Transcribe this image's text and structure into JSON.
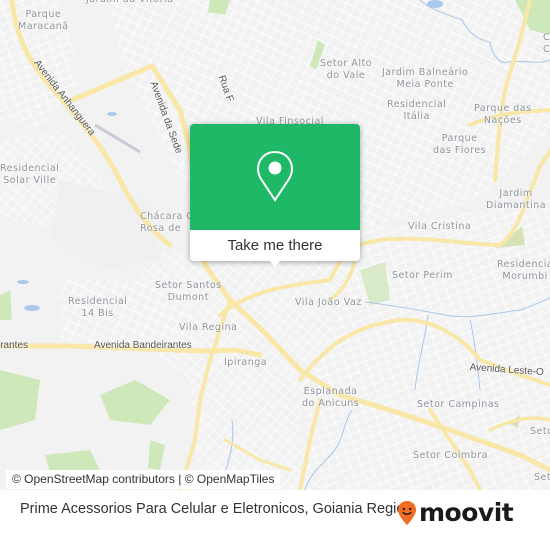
{
  "map": {
    "neighborhoods": [
      {
        "id": "parque-maracana",
        "label": "Parque\nMaracanã"
      },
      {
        "id": "setor-alto-do-vale",
        "label": "Setor Alto\ndo Vale"
      },
      {
        "id": "jardim-balneario",
        "label": "Jardim Balneário\nMeia Ponte"
      },
      {
        "id": "residencial-italia",
        "label": "Residencial\nItália"
      },
      {
        "id": "parque-das-nacoes",
        "label": "Parque das\nNações"
      },
      {
        "id": "parque-das-flores",
        "label": "Parque\ndas Flores"
      },
      {
        "id": "residencial-solar-ville",
        "label": "Residencial\nSolar Ville"
      },
      {
        "id": "vila-finsocial",
        "label": "Vila Finsocial"
      },
      {
        "id": "chacara-rosa",
        "label": "Chácara C\nRosa de"
      },
      {
        "id": "jardim-diamantina",
        "label": "Jardim\nDiamantina"
      },
      {
        "id": "vila-cristina",
        "label": "Vila Cristina"
      },
      {
        "id": "setor-perim",
        "label": "Setor Perim"
      },
      {
        "id": "residencial-morumbi",
        "label": "Residencia\nMorumbi"
      },
      {
        "id": "setor-santos-dumont",
        "label": "Setor Santos\nDumont"
      },
      {
        "id": "residencial-14-bis",
        "label": "Residencial\n14 Bis"
      },
      {
        "id": "vila-joao-vaz",
        "label": "Vila João Vaz"
      },
      {
        "id": "vila-regina",
        "label": "Vila Regina"
      },
      {
        "id": "ipiranga",
        "label": "Ipiranga"
      },
      {
        "id": "esplanada",
        "label": "Esplanada\ndo Anicuns"
      },
      {
        "id": "setor-campinas",
        "label": "Setor Campinas"
      },
      {
        "id": "setor-coimbra",
        "label": "Setor Coimbra"
      },
      {
        "id": "setor-e1",
        "label": "Seto"
      },
      {
        "id": "setor-e2",
        "label": "Set"
      },
      {
        "id": "top-cut",
        "label": "Jardim da Vitória"
      },
      {
        "id": "top-right-cut",
        "label": "C\nC"
      }
    ],
    "roads": {
      "anhanguera": "Avenida Anhanguera",
      "sede": "Avenida da Sede",
      "rua_f": "Rua F",
      "bandeirantes_left": "irantes",
      "bandeirantes": "Avenida Bandeirantes",
      "leste_oeste": "Avenida Leste-O"
    },
    "colors": {
      "background": "#f2f2f2",
      "street": "#ffffff",
      "arterial": "#f8e7a6",
      "park": "#cfe8b9",
      "water": "#a9c8ea",
      "label": "#8e949c"
    }
  },
  "popup": {
    "icon": "map-pin-icon",
    "button_label": "Take me there",
    "color": "#1fb866"
  },
  "attribution": "© OpenStreetMap contributors | © OpenMapTiles",
  "footer": {
    "title": "Prime Acessorios Para Celular e Eletronicos, Goiania Region",
    "brand": "moovit",
    "brand_color": "#f26d21"
  }
}
